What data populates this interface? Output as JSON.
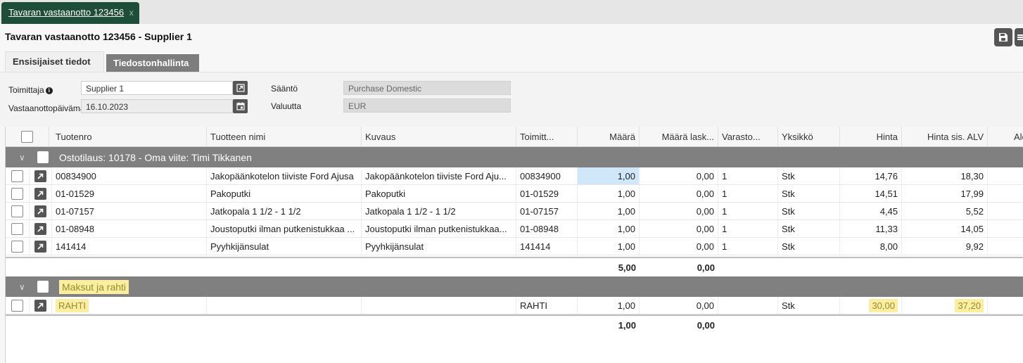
{
  "doc_tab": {
    "label": "Tavaran vastaanotto 123456",
    "close": "x"
  },
  "page": {
    "title": "Tavaran vastaanotto 123456 - Supplier 1"
  },
  "subtabs": [
    "Ensisijaiset tiedot",
    "Tiedostonhallinta"
  ],
  "form": {
    "supplier_label": "Toimittaja",
    "supplier_value": "Supplier 1",
    "date_label": "Vastaanottopäivämäärä",
    "date_value": "16.10.2023",
    "rule_label": "Sääntö",
    "rule_value": "Purchase Domestic",
    "currency_label": "Valuutta",
    "currency_value": "EUR"
  },
  "grid": {
    "columns": [
      "Tuotenro",
      "Tuotteen nimi",
      "Kuvaus",
      "Toimitt...",
      "Määrä",
      "Määrä lask...",
      "Varasto...",
      "Yksikkö",
      "Hinta",
      "Hinta sis. ALV",
      "Ale"
    ],
    "groups": [
      {
        "title": "Ostotilaus: 10178 - Oma viite: Timi Tikkanen",
        "rows": [
          {
            "tuotenro": "00834900",
            "nimi": "Jakopäänkotelon tiiviste Ford Ajusa",
            "kuvaus": "Jakopäänkotelon tiiviste Ford Aju...",
            "toimitt": "00834900",
            "maara": "1,00",
            "maara_lask": "0,00",
            "varasto": "1",
            "yksikko": "Stk",
            "hinta": "14,76",
            "hinta_alv": "18,30"
          },
          {
            "tuotenro": "01-01529",
            "nimi": "Pakoputki",
            "kuvaus": "Pakoputki",
            "toimitt": "01-01529",
            "maara": "1,00",
            "maara_lask": "0,00",
            "varasto": "1",
            "yksikko": "Stk",
            "hinta": "14,51",
            "hinta_alv": "17,99"
          },
          {
            "tuotenro": "01-07157",
            "nimi": "Jatkopala 1 1/2 - 1 1/2",
            "kuvaus": "Jatkopala 1 1/2 - 1 1/2",
            "toimitt": "01-07157",
            "maara": "1,00",
            "maara_lask": "0,00",
            "varasto": "1",
            "yksikko": "Stk",
            "hinta": "4,45",
            "hinta_alv": "5,52"
          },
          {
            "tuotenro": "01-08948",
            "nimi": "Joustoputki ilman putkenistukkaa ...",
            "kuvaus": "Joustoputki ilman putkenistukkaa...",
            "toimitt": "01-08948",
            "maara": "1,00",
            "maara_lask": "0,00",
            "varasto": "1",
            "yksikko": "Stk",
            "hinta": "11,33",
            "hinta_alv": "14,05"
          },
          {
            "tuotenro": "141414",
            "nimi": "Pyyhkijänsulat",
            "kuvaus": "Pyyhkijänsulat",
            "toimitt": "141414",
            "maara": "1,00",
            "maara_lask": "0,00",
            "varasto": "1",
            "yksikko": "Stk",
            "hinta": "8,00",
            "hinta_alv": "9,92"
          }
        ],
        "sum": {
          "maara": "5,00",
          "maara_lask": "0,00"
        }
      },
      {
        "title": "Maksut ja rahti",
        "rows": [
          {
            "tuotenro": "RAHTI",
            "nimi": "",
            "kuvaus": "",
            "toimitt": "RAHTI",
            "maara": "1,00",
            "maara_lask": "0,00",
            "varasto": "",
            "yksikko": "Stk",
            "hinta": "30,00",
            "hinta_alv": "37,20"
          }
        ],
        "sum": {
          "maara": "1,00",
          "maara_lask": "0,00"
        }
      }
    ]
  },
  "colors": {
    "tab_green": "#1e4d3a",
    "group_grey": "#808080",
    "highlight": "#fbeea0",
    "selected_cell": "#cfe7f8"
  },
  "icons": [
    "save-icon",
    "menu-icon",
    "open-link-icon",
    "calendar-icon",
    "chevron-down-icon",
    "info-icon",
    "checkbox-icon"
  ]
}
